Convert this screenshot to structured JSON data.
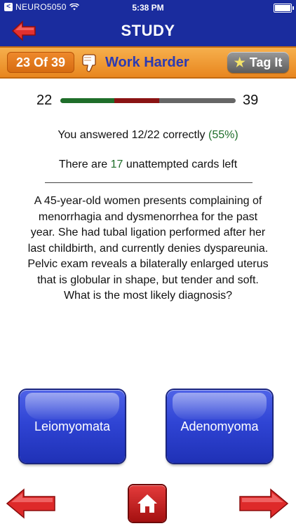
{
  "status_bar": {
    "back_label": "<",
    "carrier": "NEURO5050",
    "time": "5:38 PM"
  },
  "nav": {
    "title": "STUDY"
  },
  "card_bar": {
    "counter": "23 Of 39",
    "status": "Work Harder",
    "tag_label": "Tag It"
  },
  "progress": {
    "current": "22",
    "total": "39",
    "answered": 22,
    "correct": 12,
    "max": 39
  },
  "summary": {
    "answered_prefix": "You answered 12/22 correctly ",
    "percent": "(55%)",
    "unattempted_prefix": "There are ",
    "unattempted_count": "17",
    "unattempted_suffix": " unattempted cards left"
  },
  "question": "A 45-year-old women presents complaining of menorrhagia and dysmenorrhea for the past year. She had tubal ligation performed after her last childbirth, and currently denies dyspareunia. Pelvic exam reveals a bilaterally enlarged uterus that is globular in shape, but tender and soft. What is the most likely diagnosis?",
  "answers": [
    "Leiomyomata",
    "Adenomyoma"
  ],
  "colors": {
    "nav_blue": "#1a2c9e",
    "orange": "#e8861e",
    "correct_green": "#1f6e2a",
    "wrong_red": "#8a1313",
    "button_blue": "#2f44d4",
    "arrow_red": "#d92525"
  },
  "icons": {
    "back": "red-left-arrow-icon",
    "thumb": "thumbs-down-icon",
    "star": "star-icon",
    "prev": "red-left-arrow-icon",
    "home": "home-icon",
    "next": "red-right-arrow-icon"
  }
}
